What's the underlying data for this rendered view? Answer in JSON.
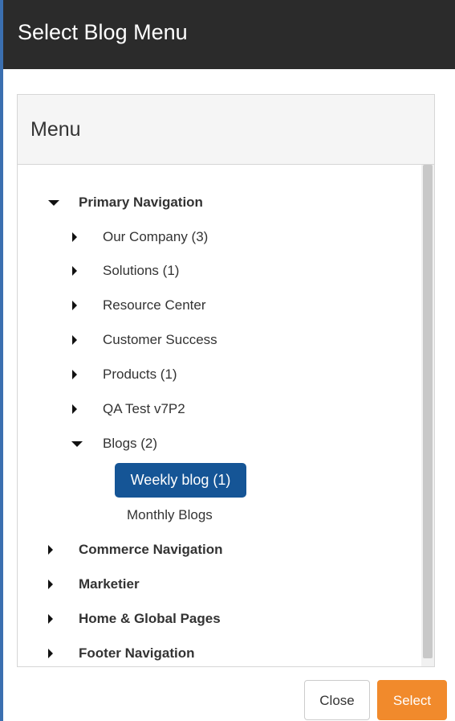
{
  "modal": {
    "title": "Select Blog Menu"
  },
  "panel": {
    "title": "Menu"
  },
  "tree": {
    "primary": {
      "label": "Primary Navigation",
      "expanded": true,
      "children": [
        {
          "label": "Our Company (3)"
        },
        {
          "label": "Solutions (1)"
        },
        {
          "label": "Resource Center"
        },
        {
          "label": "Customer Success"
        },
        {
          "label": "Products (1)"
        },
        {
          "label": "QA Test v7P2"
        },
        {
          "label": "Blogs (2)",
          "expanded": true,
          "children": [
            {
              "label": "Weekly blog (1)",
              "selected": true
            },
            {
              "label": "Monthly Blogs"
            }
          ]
        }
      ]
    },
    "roots": [
      {
        "label": "Commerce Navigation"
      },
      {
        "label": "Marketier"
      },
      {
        "label": "Home & Global Pages"
      },
      {
        "label": "Footer Navigation"
      }
    ]
  },
  "footer": {
    "close_label": "Close",
    "select_label": "Select"
  },
  "colors": {
    "header_bg": "#2b2b2b",
    "selected_bg": "#155596",
    "select_button": "#f18a2c"
  }
}
